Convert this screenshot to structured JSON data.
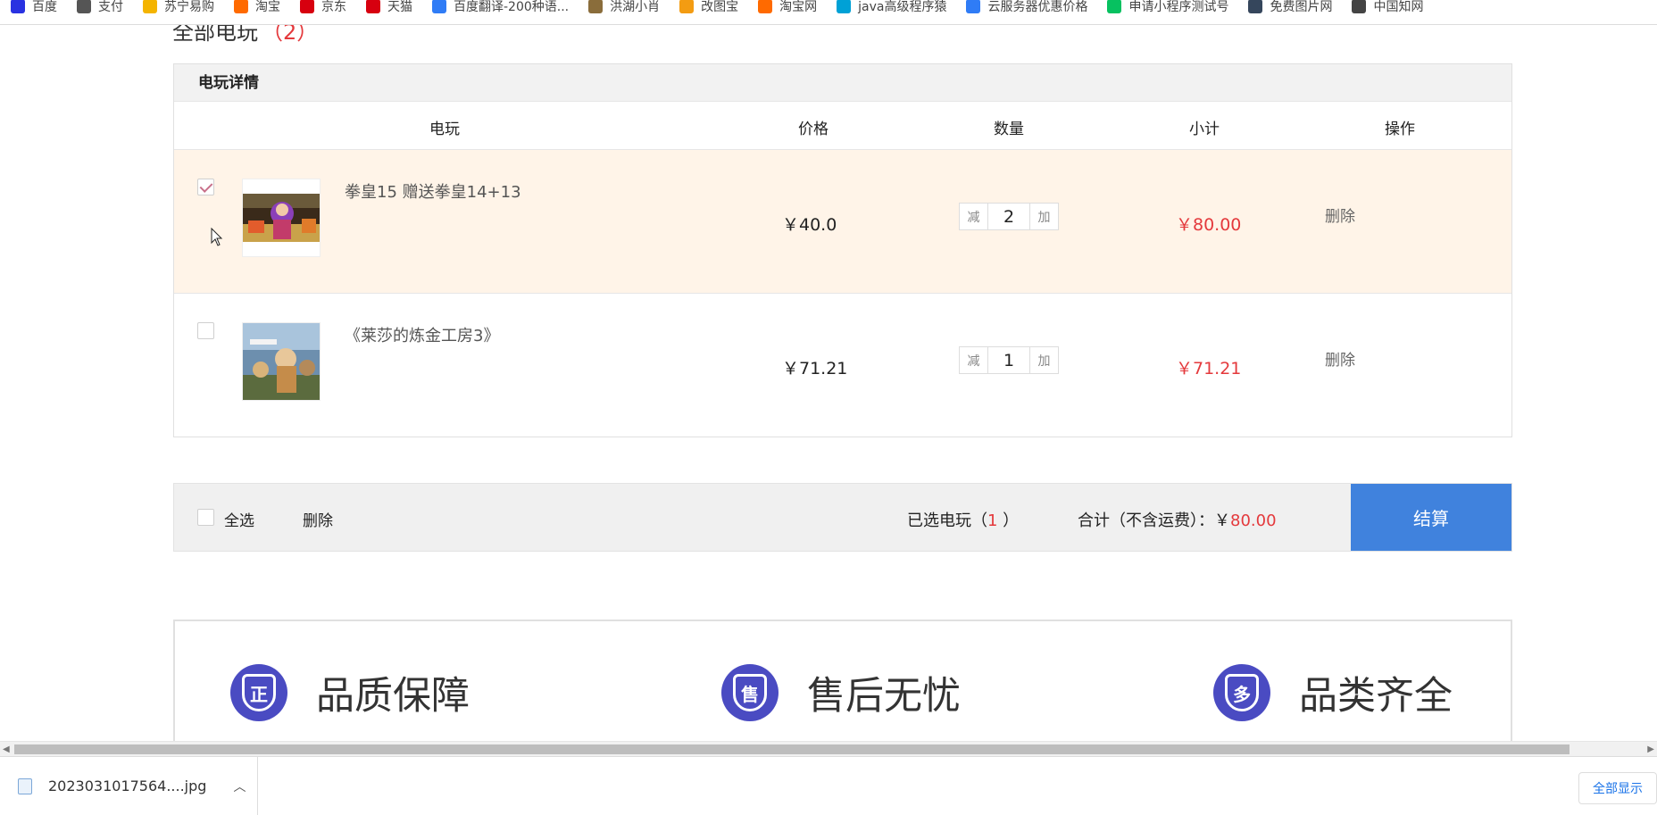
{
  "bookmarks": [
    {
      "label": "百度",
      "icon": "baidu-icon",
      "color": "#2932e1"
    },
    {
      "label": "支付",
      "icon": "globe-icon",
      "color": "#555555"
    },
    {
      "label": "苏宁易购",
      "icon": "suning-icon",
      "color": "#f4b400"
    },
    {
      "label": "淘宝",
      "icon": "taobao-icon",
      "color": "#ff6a00"
    },
    {
      "label": "京东",
      "icon": "jd-icon",
      "color": "#d7000f"
    },
    {
      "label": "天猫",
      "icon": "tmall-icon",
      "color": "#d7000f"
    },
    {
      "label": "百度翻译-200种语...",
      "icon": "translate-icon",
      "color": "#2f7cf6"
    },
    {
      "label": "洪湖小肖",
      "icon": "bird-icon",
      "color": "#8a6d3b"
    },
    {
      "label": "改图宝",
      "icon": "image-tool-icon",
      "color": "#f39c12"
    },
    {
      "label": "淘宝网",
      "icon": "taobao-icon",
      "color": "#ff6a00"
    },
    {
      "label": "java高级程序猿",
      "icon": "bilibili-icon",
      "color": "#00a1d6"
    },
    {
      "label": "云服务器优惠价格",
      "icon": "cloud-icon",
      "color": "#2f7cf6"
    },
    {
      "label": "申请小程序测试号",
      "icon": "wechat-icon",
      "color": "#07c160"
    },
    {
      "label": "免费图片网",
      "icon": "tumblr-icon",
      "color": "#35465c"
    },
    {
      "label": "中国知网",
      "icon": "cnki-icon",
      "color": "#444444"
    }
  ],
  "section": {
    "title": "全部电玩",
    "count": "（2）"
  },
  "cart": {
    "header": "电玩详情",
    "columns": {
      "game": "电玩",
      "price": "价格",
      "qty": "数量",
      "subtotal": "小计",
      "action": "操作"
    },
    "minus_label": "减",
    "plus_label": "加",
    "items": [
      {
        "name": "拳皇15 赠送拳皇14+13",
        "price": "￥40.0",
        "qty": "2",
        "subtotal": "￥80.00",
        "delete": "删除",
        "checked": true
      },
      {
        "name": "《莱莎的炼金工房3》",
        "price": "￥71.21",
        "qty": "1",
        "subtotal": "￥71.21",
        "delete": "删除",
        "checked": false
      }
    ]
  },
  "footer": {
    "select_all": "全选",
    "delete": "删除",
    "selected_prefix": "已选电玩（",
    "selected_count": "1",
    "selected_suffix": " ）",
    "total_label": "合计（不含运费）：",
    "total_currency": "￥",
    "total_value": "80.00",
    "checkout": "结算"
  },
  "promises": [
    {
      "glyph": "正",
      "label": "品质保障",
      "icon": "quality-shield-icon"
    },
    {
      "glyph": "售",
      "label": "售后无忧",
      "icon": "aftersale-shield-icon"
    },
    {
      "glyph": "多",
      "label": "品类齐全",
      "icon": "variety-shield-icon"
    }
  ],
  "download": {
    "file": "2023031017564....jpg",
    "show_all": "全部显示"
  },
  "colors": {
    "accent": "#4082dd",
    "price_red": "#e4393c",
    "selected_row": "#fff4e8",
    "badge": "#4a4bc2"
  }
}
